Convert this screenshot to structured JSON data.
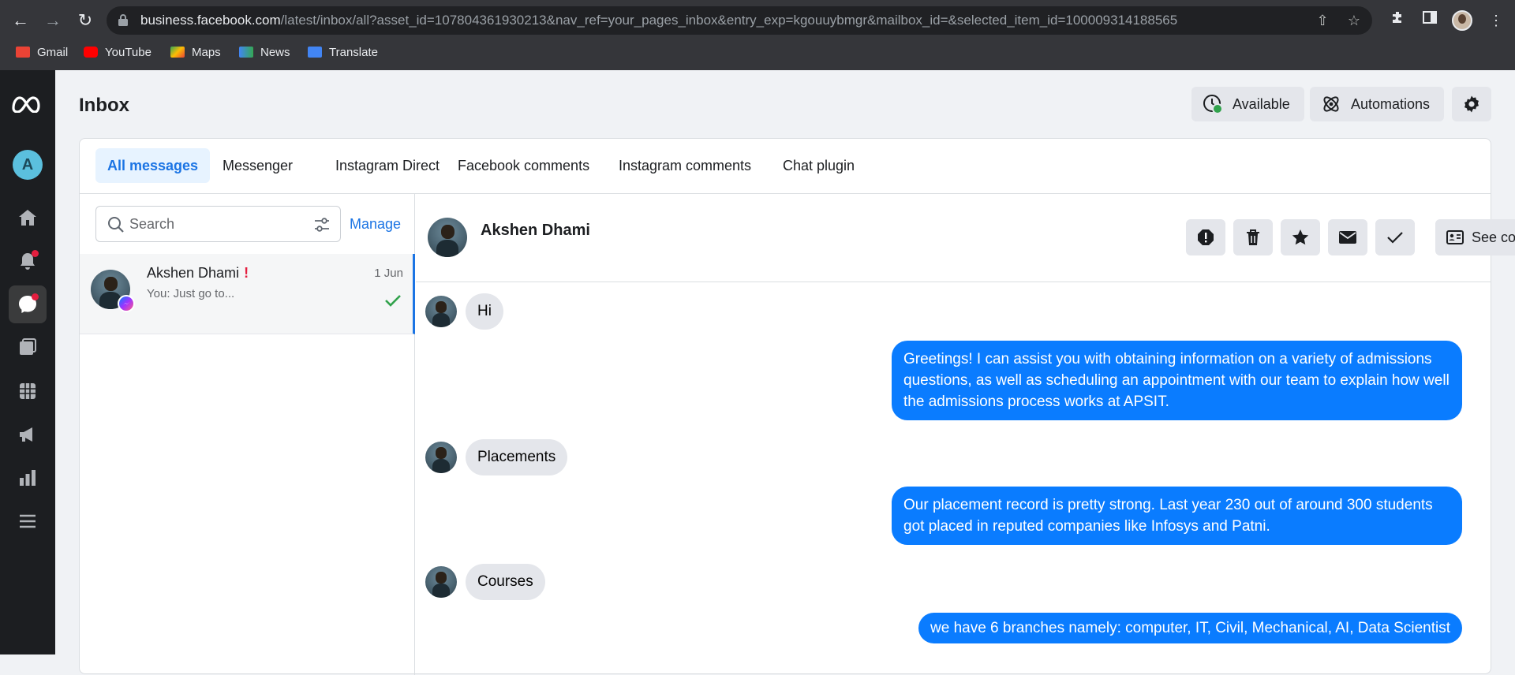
{
  "browser": {
    "url_host": "business.facebook.com",
    "url_path": "/latest/inbox/all?asset_id=107804361930213&nav_ref=your_pages_inbox&entry_exp=kgouuybmgr&mailbox_id=&selected_item_id=100009314188565",
    "bookmarks": [
      {
        "label": "Gmail",
        "icon": "gmail-icon",
        "color": "#ea4335"
      },
      {
        "label": "YouTube",
        "icon": "youtube-icon",
        "color": "#ff0000"
      },
      {
        "label": "Maps",
        "icon": "maps-icon",
        "color": "#34a853"
      },
      {
        "label": "News",
        "icon": "news-icon",
        "color": "#4285f4"
      },
      {
        "label": "Translate",
        "icon": "translate-icon",
        "color": "#4285f4"
      }
    ]
  },
  "rail": {
    "account_initial": "A",
    "items": [
      "home-icon",
      "notifications-icon",
      "inbox-icon",
      "posts-icon",
      "planner-icon",
      "ads-icon",
      "insights-icon",
      "menu-icon"
    ]
  },
  "header": {
    "title": "Inbox",
    "available_label": "Available",
    "automations_label": "Automations"
  },
  "tabs": [
    "All messages",
    "Messenger",
    "Instagram Direct",
    "Facebook comments",
    "Instagram comments",
    "Chat plugin"
  ],
  "list": {
    "search_placeholder": "Search",
    "manage_label": "Manage",
    "conversation": {
      "name": "Akshen Dhami",
      "alert": "!",
      "time": "1 Jun",
      "snippet": "You: Just go to..."
    }
  },
  "chat": {
    "contact_name": "Akshen Dhami",
    "see_contact_label": "See contact",
    "messages": [
      {
        "dir": "in",
        "text": "Hi"
      },
      {
        "dir": "out",
        "text": "Greetings! I can assist you with obtaining information on a variety of admissions questions, as well as scheduling an appointment with our team to explain how well the admissions process works at APSIT."
      },
      {
        "dir": "in",
        "text": "Placements"
      },
      {
        "dir": "out",
        "text": "Our placement record is pretty strong. Last year 230 out of around 300 students got placed in reputed companies like Infosys and Patni."
      },
      {
        "dir": "in",
        "text": "Courses"
      },
      {
        "dir": "out",
        "text": "we have 6 branches namely: computer, IT, Civil, Mechanical, AI, Data Scientist"
      }
    ]
  },
  "colors": {
    "accent": "#1b74e4",
    "outgoing_bubble": "#0a7cff",
    "available_dot": "#31a24c",
    "alert": "#e41e3f"
  }
}
